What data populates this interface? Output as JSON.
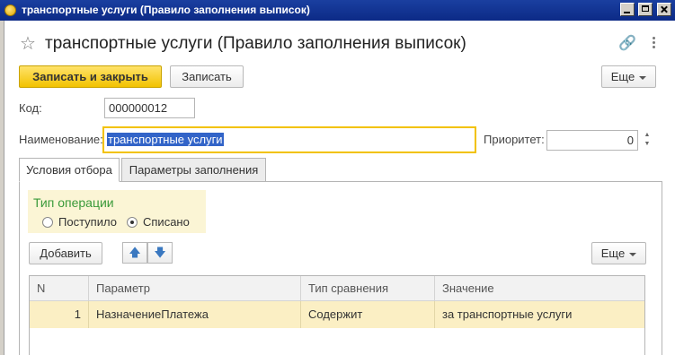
{
  "window": {
    "title": "транспортные услуги (Правило заполнения выписок)"
  },
  "header": {
    "title": "транспортные услуги (Правило заполнения выписок)"
  },
  "toolbar": {
    "save_close_label": "Записать и закрыть",
    "save_label": "Записать",
    "more_label": "Еще"
  },
  "form": {
    "code_label": "Код:",
    "code_value": "000000012",
    "name_label": "Наименование:",
    "name_value": "транспортные услуги",
    "priority_label": "Приоритет:",
    "priority_value": "0"
  },
  "tabs": [
    {
      "label": "Условия отбора"
    },
    {
      "label": "Параметры заполнения"
    }
  ],
  "operation_type": {
    "label": "Тип операции",
    "options": [
      {
        "label": "Поступило",
        "selected": false
      },
      {
        "label": "Списано",
        "selected": true
      }
    ]
  },
  "table_toolbar": {
    "add_label": "Добавить",
    "more_label": "Еще",
    "up_icon": "arrow-up-icon",
    "down_icon": "arrow-down-icon"
  },
  "table": {
    "columns": [
      "N",
      "Параметр",
      "Тип сравнения",
      "Значение"
    ],
    "rows": [
      {
        "n": "1",
        "param": "НазначениеПлатежа",
        "compare": "Содержит",
        "value": "за транспортные услуги"
      }
    ]
  },
  "colors": {
    "accent": "#f2c200",
    "titlebar": "#0c2a86",
    "selected_row": "#fbefc4",
    "group_header": "#3a9a3a"
  }
}
